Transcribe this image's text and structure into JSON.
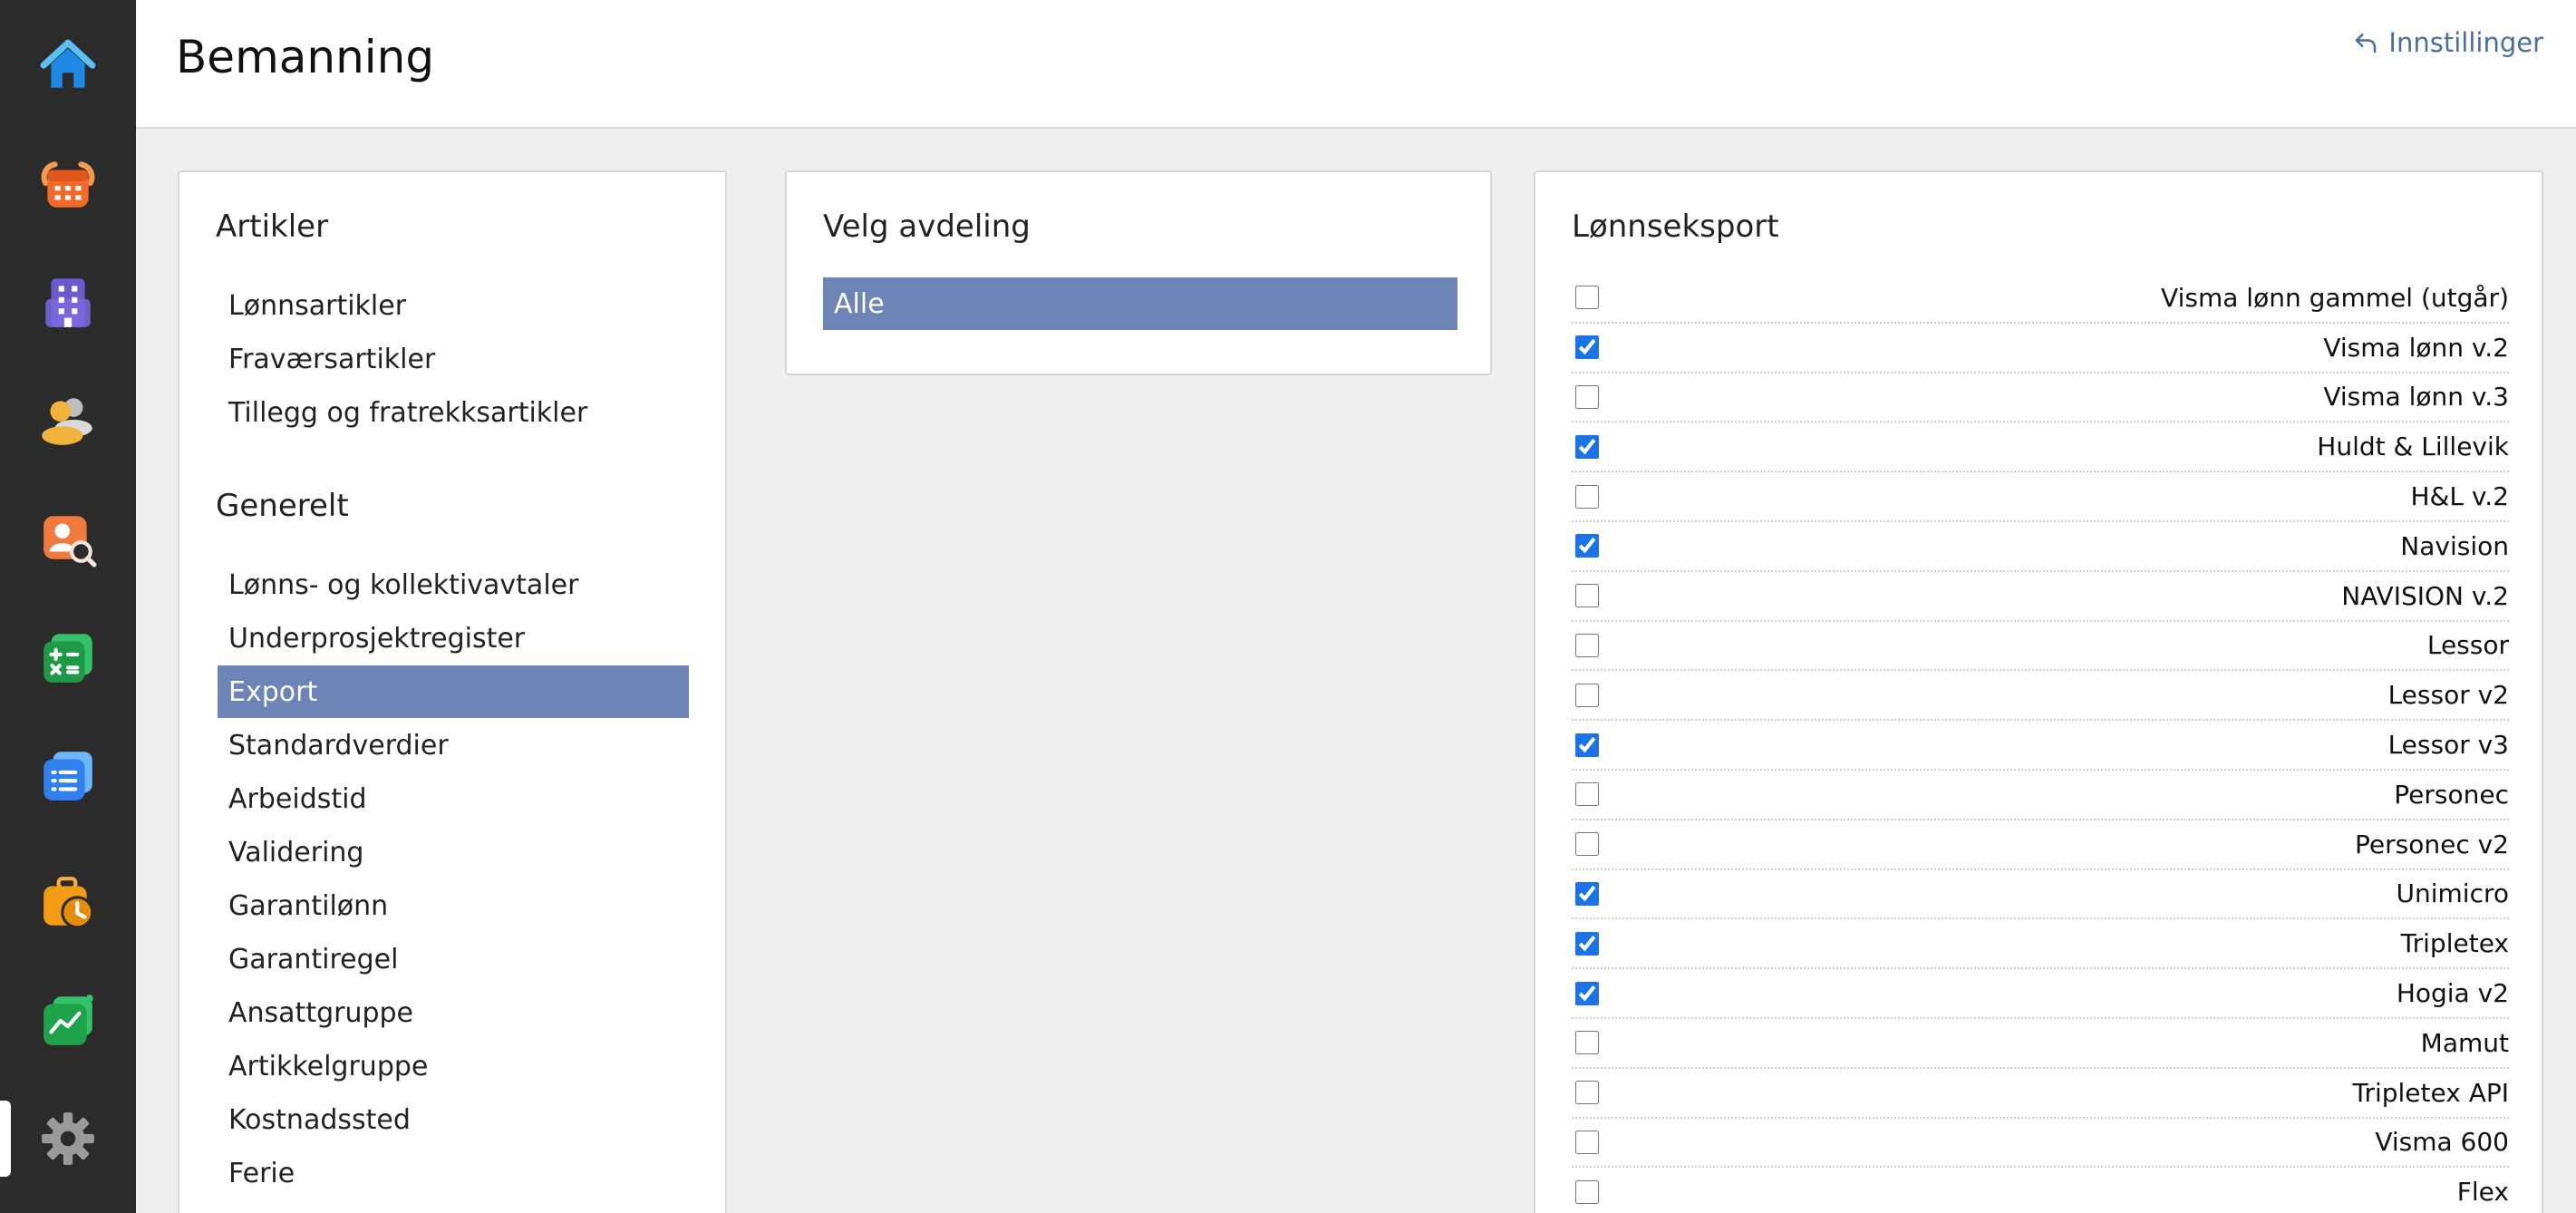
{
  "header": {
    "title": "Bemanning",
    "settings_link": "Innstillinger"
  },
  "rail": {
    "items": [
      {
        "icon": "home-icon",
        "color": "#1e88e5"
      },
      {
        "icon": "calendar-icon",
        "color": "#f06a2a"
      },
      {
        "icon": "building-icon",
        "color": "#6a5acd"
      },
      {
        "icon": "users-icon",
        "color": "#f2b33d"
      },
      {
        "icon": "user-search-icon",
        "color": "#f07a3e"
      },
      {
        "icon": "calculator-icon",
        "color": "#22a24a"
      },
      {
        "icon": "document-list-icon",
        "color": "#2f80ed"
      },
      {
        "icon": "briefcase-clock-icon",
        "color": "#f39c12"
      },
      {
        "icon": "chart-icon",
        "color": "#1fa34a"
      },
      {
        "icon": "gear-icon",
        "color": "#9a9a9a"
      }
    ],
    "active_index": 9
  },
  "articles": {
    "title": "Artikler",
    "items": [
      "Lønnsartikler",
      "Fraværsartikler",
      "Tillegg og fratrekksartikler"
    ]
  },
  "general": {
    "title": "Generelt",
    "items": [
      "Lønns- og kollektivavtaler",
      "Underprosjektregister",
      "Export",
      "Standardverdier",
      "Arbeidstid",
      "Validering",
      "Garantilønn",
      "Garantiregel",
      "Ansattgruppe",
      "Artikkelgruppe",
      "Kostnadssted",
      "Ferie"
    ],
    "selected_index": 2
  },
  "department": {
    "title": "Velg avdeling",
    "selected": "Alle"
  },
  "payroll_export": {
    "title": "Lønnseksport",
    "items": [
      {
        "label": "Visma lønn gammel (utgår)",
        "checked": false
      },
      {
        "label": "Visma lønn v.2",
        "checked": true
      },
      {
        "label": "Visma lønn v.3",
        "checked": false
      },
      {
        "label": "Huldt & Lillevik",
        "checked": true
      },
      {
        "label": "H&L v.2",
        "checked": false
      },
      {
        "label": "Navision",
        "checked": true
      },
      {
        "label": "NAVISION v.2",
        "checked": false
      },
      {
        "label": "Lessor",
        "checked": false
      },
      {
        "label": "Lessor v2",
        "checked": false
      },
      {
        "label": "Lessor v3",
        "checked": true
      },
      {
        "label": "Personec",
        "checked": false
      },
      {
        "label": "Personec v2",
        "checked": false
      },
      {
        "label": "Unimicro",
        "checked": true
      },
      {
        "label": "Tripletex",
        "checked": true
      },
      {
        "label": "Hogia v2",
        "checked": true
      },
      {
        "label": "Mamut",
        "checked": false
      },
      {
        "label": "Tripletex API",
        "checked": false
      },
      {
        "label": "Visma 600",
        "checked": false
      },
      {
        "label": "Flex",
        "checked": false
      }
    ]
  },
  "colors": {
    "selected_bg": "#6c85b6",
    "link": "#4a6f9a",
    "rail_bg": "#2b2b2b"
  }
}
